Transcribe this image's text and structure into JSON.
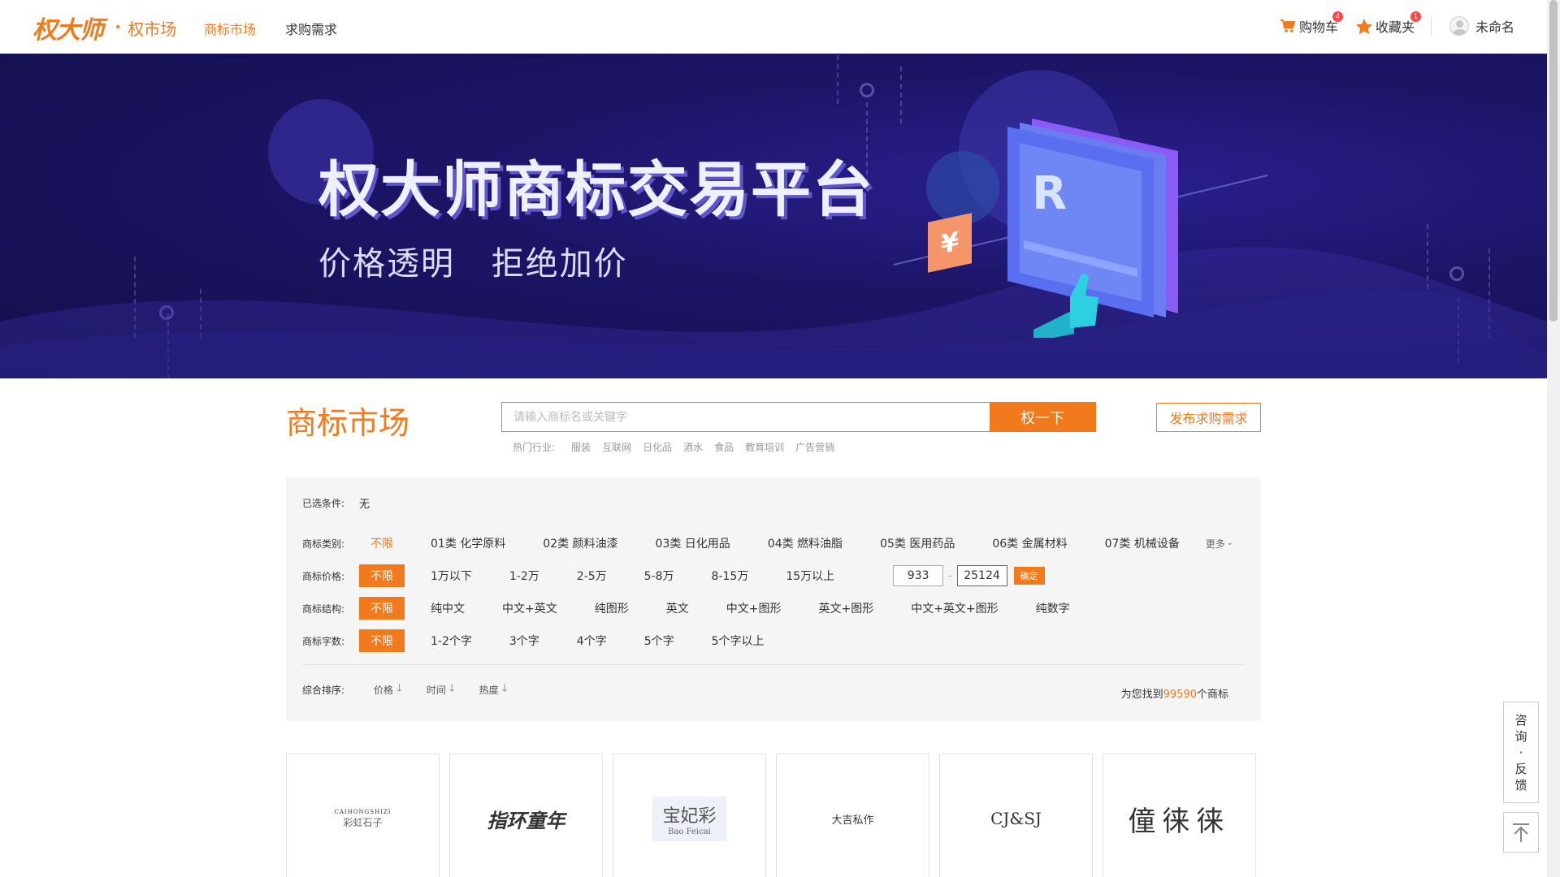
{
  "header": {
    "logo_text": "权大师",
    "logo_sub": "权市场",
    "nav": [
      {
        "label": "商标市场",
        "active": true
      },
      {
        "label": "求购需求",
        "active": false
      }
    ],
    "cart_label": "购物车",
    "cart_count": "4",
    "favorites_label": "收藏夹",
    "favorites_count": "1",
    "user_name": "未命名"
  },
  "banner": {
    "title": "权大师商标交易平台",
    "sub_left": "价格透明",
    "sub_right": "拒绝加价",
    "badge_letter": "R",
    "yen": "¥"
  },
  "search": {
    "title": "商标市场",
    "placeholder": "请输入商标名或关键字",
    "button": "权一下",
    "publish_button": "发布求购需求",
    "hot_label": "热门行业:",
    "hot_items": [
      "服装",
      "互联网",
      "日化品",
      "酒水",
      "食品",
      "教育培训",
      "广告营销"
    ]
  },
  "filters": {
    "selected_label": "已选条件:",
    "selected_value": "无",
    "category": {
      "label": "商标类别:",
      "options": [
        "不限",
        "01类 化学原料",
        "02类 颜料油漆",
        "03类 日化用品",
        "04类 燃料油脂",
        "05类 医用药品",
        "06类 金属材料",
        "07类 机械设备"
      ],
      "more": "更多"
    },
    "price": {
      "label": "商标价格:",
      "options": [
        "不限",
        "1万以下",
        "1-2万",
        "2-5万",
        "5-8万",
        "8-15万",
        "15万以上"
      ],
      "min": "933",
      "max": "25124",
      "dash": "-",
      "confirm": "确定"
    },
    "structure": {
      "label": "商标结构:",
      "options": [
        "不限",
        "纯中文",
        "中文+英文",
        "纯图形",
        "英文",
        "中文+图形",
        "英文+图形",
        "中文+英文+图形",
        "纯数字"
      ]
    },
    "length": {
      "label": "商标字数:",
      "options": [
        "不限",
        "1-2个字",
        "3个字",
        "4个字",
        "5个字",
        "5个字以上"
      ]
    },
    "sort": {
      "label": "综合排序:",
      "options": [
        "价格",
        "时间",
        "热度"
      ]
    },
    "result_prefix": "为您找到",
    "result_count": "99590",
    "result_suffix": "个商标"
  },
  "cards": [
    {
      "line1": "CAIHONGSHIZI",
      "line2": "彩虹石子"
    },
    {
      "line1": "指环童年",
      "line2": ""
    },
    {
      "line1": "宝妃彩",
      "line2": "Bao Feicai"
    },
    {
      "line1": "大吉私作",
      "line2": ""
    },
    {
      "line1": "CJ&SJ",
      "line2": ""
    },
    {
      "line1": "僮徕徕",
      "line2": ""
    }
  ],
  "side": {
    "consult": [
      "咨",
      "询",
      "·",
      "反",
      "馈"
    ]
  },
  "colors": {
    "accent": "#f07a1c",
    "banner_bg": "#1c1567"
  }
}
